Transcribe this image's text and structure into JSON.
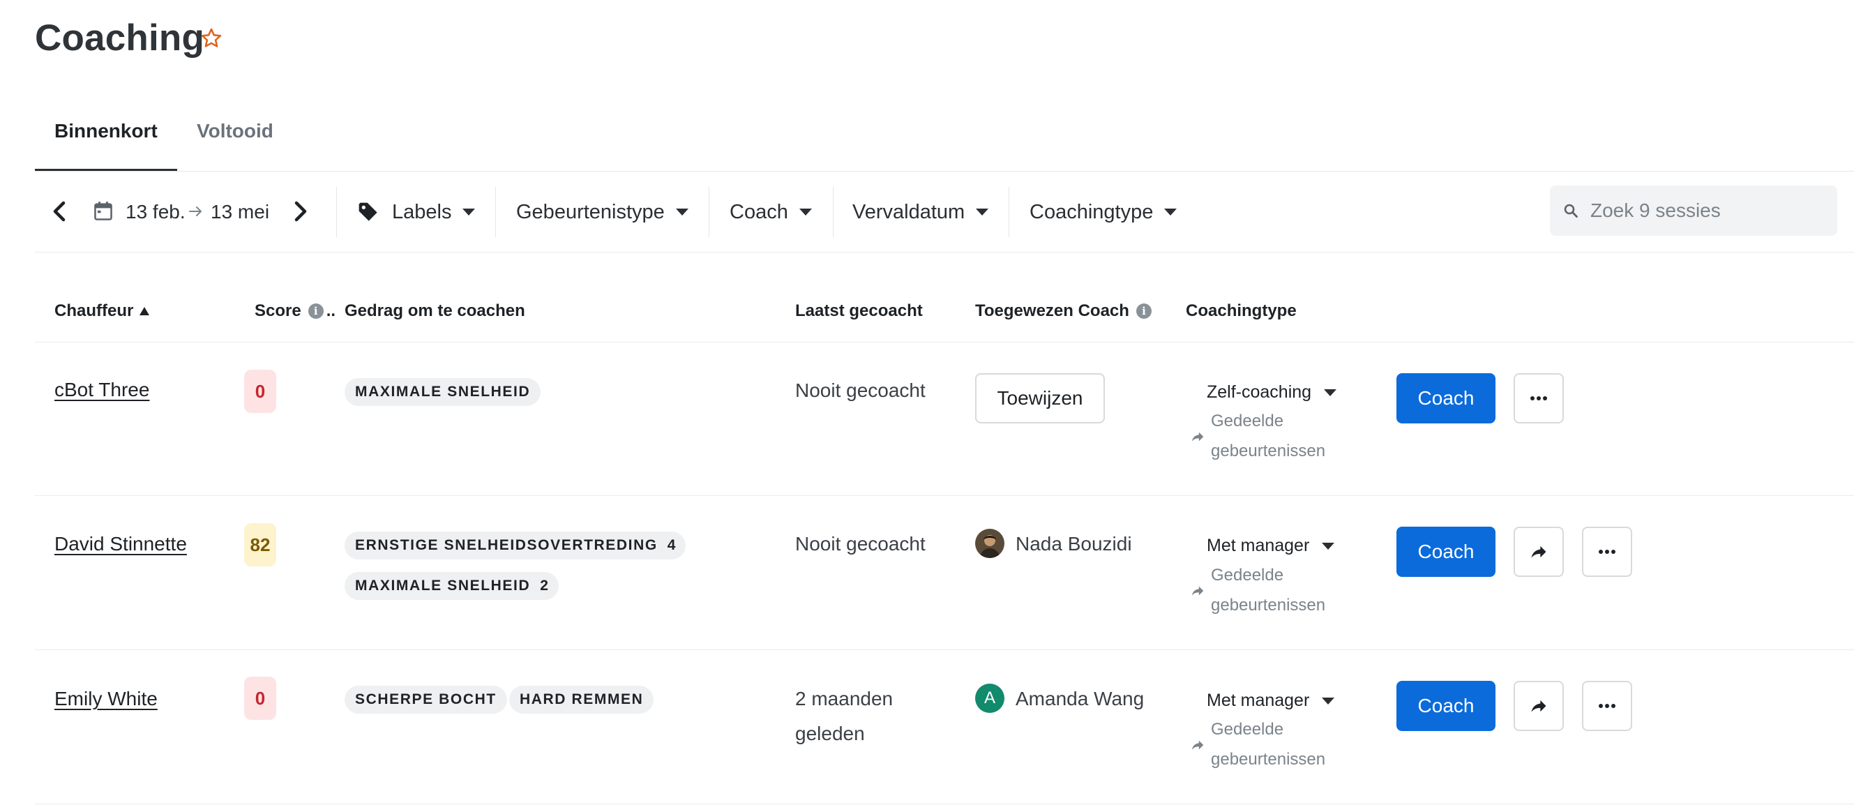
{
  "page": {
    "title": "Coaching"
  },
  "tabs": [
    {
      "label": "Binnenkort",
      "active": true
    },
    {
      "label": "Voltooid",
      "active": false
    }
  ],
  "filters": {
    "date_start": "13 feb.",
    "date_end": "13 mei",
    "labels": "Labels",
    "event_type": "Gebeurtenistype",
    "coach": "Coach",
    "due_date": "Vervaldatum",
    "coaching_type": "Coachingtype"
  },
  "search": {
    "placeholder": "Zoek 9 sessies",
    "value": ""
  },
  "table": {
    "headers": {
      "driver": "Chauffeur",
      "score": "Score",
      "behavior": "Gedrag om te coachen",
      "last_coached": "Laatst gecoacht",
      "assigned_coach": "Toegewezen Coach",
      "coaching_type": "Coachingtype"
    },
    "rows": [
      {
        "driver": "cBot Three",
        "score": "0",
        "score_level": "red",
        "tags": [
          {
            "label": "MAXIMALE SNELHEID",
            "count": ""
          }
        ],
        "last_coached": [
          "Nooit gecoacht"
        ],
        "coach": {
          "assign_label": "Toewijzen",
          "name": "",
          "initial": ""
        },
        "coaching_type": "Zelf-coaching",
        "shared_events": [
          "Gedeelde",
          "gebeurtenissen"
        ],
        "coach_button": "Coach"
      },
      {
        "driver": "David Stinnette",
        "score": "82",
        "score_level": "yellow",
        "tags": [
          {
            "label": "ERNSTIGE SNELHEIDSOVERTREDING",
            "count": "4"
          },
          {
            "label": "MAXIMALE SNELHEID",
            "count": "2"
          }
        ],
        "last_coached": [
          "Nooit gecoacht"
        ],
        "coach": {
          "assign_label": "",
          "name": "Nada Bouzidi",
          "initial": ""
        },
        "coaching_type": "Met manager",
        "shared_events": [
          "Gedeelde",
          "gebeurtenissen"
        ],
        "coach_button": "Coach"
      },
      {
        "driver": "Emily White",
        "score": "0",
        "score_level": "red",
        "tags": [
          {
            "label": "SCHERPE BOCHT",
            "count": ""
          },
          {
            "label": "HARD REMMEN",
            "count": ""
          }
        ],
        "last_coached": [
          "2 maanden",
          "geleden"
        ],
        "coach": {
          "assign_label": "",
          "name": "Amanda Wang",
          "initial": "A"
        },
        "coaching_type": "Met manager",
        "shared_events": [
          "Gedeelde",
          "gebeurtenissen"
        ],
        "coach_button": "Coach"
      }
    ]
  },
  "colors": {
    "primary": "#0b6bdb",
    "star": "#e0621e",
    "score_red_bg": "#fde3e4",
    "score_red_text": "#c7252f",
    "score_yellow_bg": "#fdf3cc",
    "score_yellow_text": "#7a5b00",
    "avatar_green": "#128a6c"
  },
  "icons": {
    "favorite": "star-outline-icon",
    "prev": "chevron-left-icon",
    "next": "chevron-right-icon",
    "calendar": "calendar-icon",
    "arrow": "arrow-right-icon",
    "label": "tag-icon",
    "search": "search-icon",
    "info": "info-icon",
    "sort": "sort-ascending-icon",
    "share": "share-icon",
    "more": "more-horizontal-icon"
  }
}
